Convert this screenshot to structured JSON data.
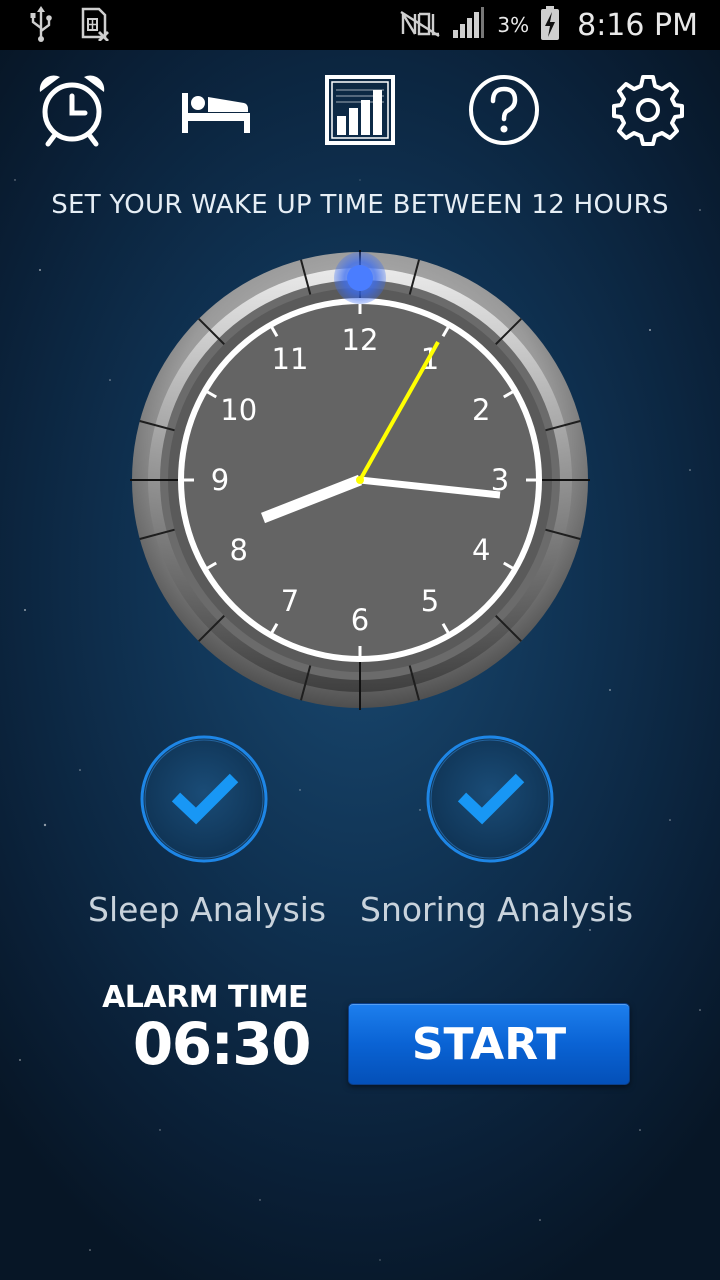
{
  "status_bar": {
    "battery_percent": "3%",
    "time": "8:16 PM",
    "icons": [
      "usb-icon",
      "sim-card-error-icon",
      "no-signal-icon",
      "signal-icon",
      "battery-charging-icon"
    ]
  },
  "toolbar": {
    "items": [
      {
        "icon": "alarm-clock-icon",
        "label": "Alarm"
      },
      {
        "icon": "bed-icon",
        "label": "Sleep"
      },
      {
        "icon": "bar-chart-icon",
        "label": "Statistics"
      },
      {
        "icon": "help-icon",
        "label": "Help"
      },
      {
        "icon": "gear-icon",
        "label": "Settings"
      }
    ]
  },
  "instruction": "SET YOUR WAKE UP TIME BETWEEN 12 HOURS",
  "clock": {
    "numbers": [
      "12",
      "1",
      "2",
      "3",
      "4",
      "5",
      "6",
      "7",
      "8",
      "9",
      "10",
      "11"
    ],
    "hour_hand_color": "#ffffff",
    "minute_hand_color": "#ffffff",
    "second_hand_color": "#ffff00",
    "handle_color": "#3a7bf2"
  },
  "toggles": [
    {
      "label": "Sleep Analysis",
      "checked": true
    },
    {
      "label": "Snoring Analysis",
      "checked": true
    }
  ],
  "alarm": {
    "label": "ALARM TIME",
    "time": "06:30"
  },
  "start_button": {
    "label": "START",
    "color": "#0a63d4"
  }
}
